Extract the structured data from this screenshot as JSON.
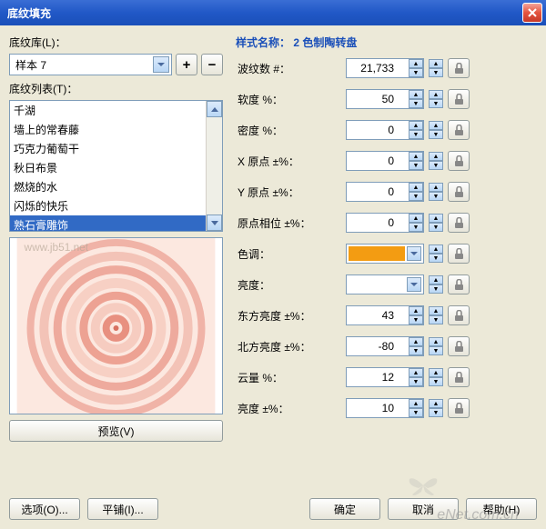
{
  "window": {
    "title": "底纹填充"
  },
  "left": {
    "library_label": "底纹库(L)：",
    "library_value": "样本 7",
    "list_label": "底纹列表(T)：",
    "items": [
      "千湖",
      "墙上的常春藤",
      "巧克力葡萄干",
      "秋日布景",
      "燃烧的水",
      "闪烁的快乐",
      "熟石膏雕饰"
    ],
    "selected_index": 6,
    "preview_btn": "预览(V)"
  },
  "right": {
    "style_prefix": "样式名称：",
    "style_name": "2 色制陶转盘",
    "params": [
      {
        "label": "波纹数 #：",
        "value": "21,733",
        "type": "spin"
      },
      {
        "label": "软度 %：",
        "value": "50",
        "type": "spin"
      },
      {
        "label": "密度 %：",
        "value": "0",
        "type": "spin"
      },
      {
        "label": "X 原点 ±%：",
        "value": "0",
        "type": "spin"
      },
      {
        "label": "Y 原点 ±%：",
        "value": "0",
        "type": "spin"
      },
      {
        "label": "原点相位 ±%：",
        "value": "0",
        "type": "spin"
      },
      {
        "label": "色调：",
        "value": "#f39c12",
        "type": "color"
      },
      {
        "label": "亮度：",
        "value": "#ffffff",
        "type": "color"
      },
      {
        "label": "东方亮度 ±%：",
        "value": "43",
        "type": "spin"
      },
      {
        "label": "北方亮度 ±%：",
        "value": "-80",
        "type": "spin"
      },
      {
        "label": "云量 %：",
        "value": "12",
        "type": "spin"
      },
      {
        "label": "亮度 ±%：",
        "value": "10",
        "type": "spin"
      }
    ]
  },
  "footer": {
    "options": "选项(O)...",
    "tile": "平铺(I)...",
    "ok": "确定",
    "cancel": "取消",
    "help": "帮助(H)"
  },
  "watermark": "eNet.com.cn"
}
